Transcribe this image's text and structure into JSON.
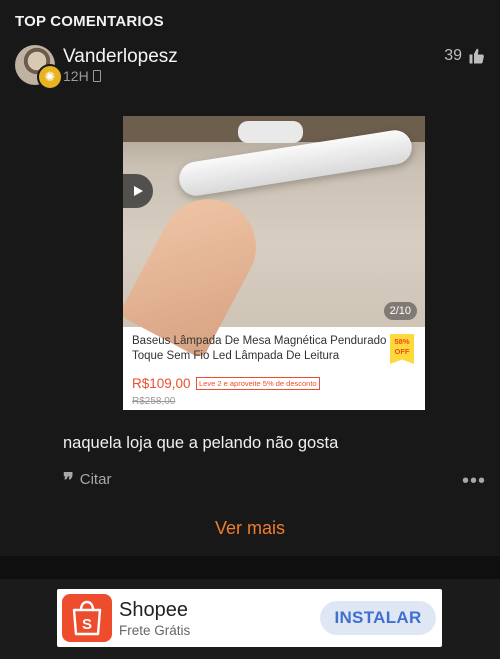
{
  "section": {
    "title": "TOP COMENTARIOS"
  },
  "comment": {
    "username": "Vanderlopesz",
    "time": "12H",
    "likes": "39",
    "text": "naquela loja que a pelando não gosta",
    "quote_label": "Citar"
  },
  "product": {
    "image_counter": "2/10",
    "title": "Baseus Lâmpada De Mesa Magnética Pendurado Toque Sem Fio Led Lâmpada De Leitura",
    "discount_percent": "58%",
    "discount_label": "OFF",
    "price": "R$109,00",
    "promo": "Leve 2 e aproveite 5% de desconto",
    "old_price": "R$258,00"
  },
  "see_more": "Ver mais",
  "ad": {
    "title": "Shopee",
    "subtitle": "Frete Grátis",
    "install_label": "INSTALAR",
    "logo_letter": "S"
  },
  "colors": {
    "background": "#181818",
    "accent": "#f07d2c",
    "shopee": "#ee4d2d",
    "install_text": "#3f6fd1"
  }
}
